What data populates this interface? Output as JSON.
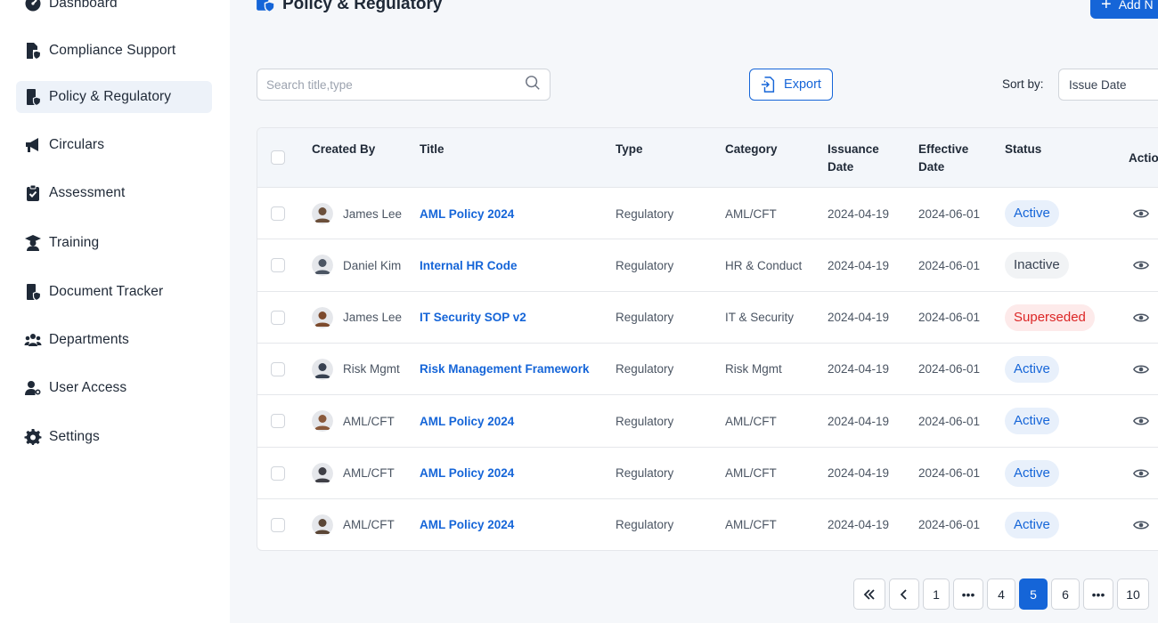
{
  "sidebar": {
    "items": [
      {
        "label": "Dashboard",
        "icon": "dashboard-icon"
      },
      {
        "label": "Compliance Support",
        "icon": "document-shield-icon"
      },
      {
        "label": "Policy & Regulatory",
        "icon": "document-shield-icon",
        "active": true
      },
      {
        "label": "Circulars",
        "icon": "megaphone-icon"
      },
      {
        "label": "Assessment",
        "icon": "clipboard-check-icon"
      },
      {
        "label": "Training",
        "icon": "graduate-icon"
      },
      {
        "label": "Document Tracker",
        "icon": "document-shield-icon"
      },
      {
        "label": "Departments",
        "icon": "users-icon"
      },
      {
        "label": "User Access",
        "icon": "user-key-icon"
      },
      {
        "label": "Settings",
        "icon": "gear-icon"
      }
    ]
  },
  "header": {
    "title": "Policy & Regulatory",
    "add_label": "Add N"
  },
  "toolbar": {
    "search_placeholder": "Search title,type",
    "export_label": "Export",
    "sort_label": "Sort by:",
    "sort_value": "Issue Date"
  },
  "table": {
    "columns": {
      "created_by": "Created  By",
      "title": "Title",
      "type": "Type",
      "category": "Category",
      "issuance_1": "Issuance",
      "issuance_2": "Date",
      "effective_1": "Effective",
      "effective_2": "Date",
      "status": "Status",
      "action": "Actio"
    },
    "rows": [
      {
        "created_by": "James Lee",
        "title": "AML Policy 2024",
        "type": "Regulatory",
        "category": "AML/CFT",
        "issuance": "2024-04-19",
        "effective": "2024-06-01",
        "status": "Active"
      },
      {
        "created_by": "Daniel Kim",
        "title": "Internal HR Code",
        "type": "Regulatory",
        "category": "HR & Conduct",
        "issuance": "2024-04-19",
        "effective": "2024-06-01",
        "status": "Inactive"
      },
      {
        "created_by": "James Lee",
        "title": "IT Security SOP v2",
        "type": "Regulatory",
        "category": "IT & Security",
        "issuance": "2024-04-19",
        "effective": "2024-06-01",
        "status": "Superseded"
      },
      {
        "created_by": "Risk Mgmt",
        "title": "Risk Management Framework",
        "type": "Regulatory",
        "category": "Risk Mgmt",
        "issuance": "2024-04-19",
        "effective": "2024-06-01",
        "status": "Active"
      },
      {
        "created_by": "AML/CFT",
        "title": "AML Policy 2024",
        "type": "Regulatory",
        "category": "AML/CFT",
        "issuance": "2024-04-19",
        "effective": "2024-06-01",
        "status": "Active"
      },
      {
        "created_by": "AML/CFT",
        "title": "AML Policy 2024",
        "type": "Regulatory",
        "category": "AML/CFT",
        "issuance": "2024-04-19",
        "effective": "2024-06-01",
        "status": "Active"
      },
      {
        "created_by": "AML/CFT",
        "title": "AML Policy 2024",
        "type": "Regulatory",
        "category": "AML/CFT",
        "issuance": "2024-04-19",
        "effective": "2024-06-01",
        "status": "Active"
      }
    ]
  },
  "pagination": {
    "pages": [
      "1",
      "•••",
      "4",
      "5",
      "6",
      "•••",
      "10"
    ],
    "current": "5"
  },
  "colors": {
    "accent": "#1565d8",
    "active_bg": "#e8f0fb",
    "superseded": "#dc2626"
  }
}
